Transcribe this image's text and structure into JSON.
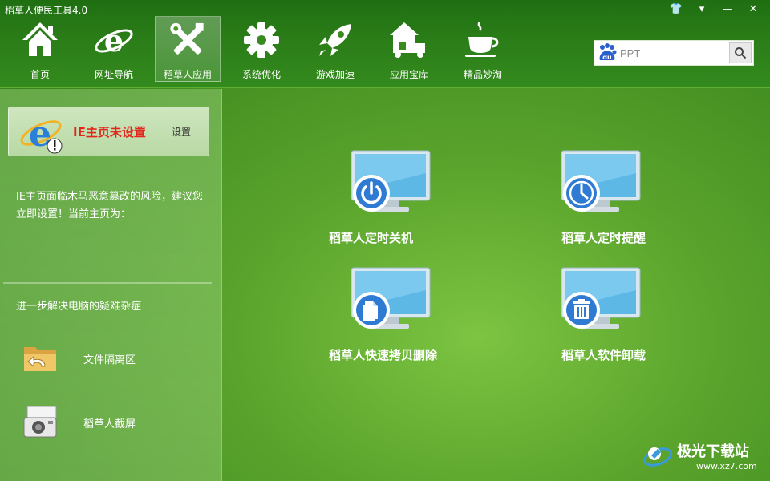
{
  "window": {
    "title": "稻草人便民工具4.0",
    "buttons": {
      "skin": "👕",
      "menu": "▾",
      "minimize": "—",
      "close": "✕"
    }
  },
  "nav": {
    "items": [
      {
        "label": "首页",
        "icon": "home-icon"
      },
      {
        "label": "网址导航",
        "icon": "ie-browser-icon"
      },
      {
        "label": "稻草人应用",
        "icon": "tools-icon",
        "active": true
      },
      {
        "label": "系统优化",
        "icon": "gear-icon"
      },
      {
        "label": "游戏加速",
        "icon": "rocket-icon"
      },
      {
        "label": "应用宝库",
        "icon": "store-icon"
      },
      {
        "label": "精品妙淘",
        "icon": "coffee-cup-icon"
      }
    ]
  },
  "search": {
    "placeholder": "PPT",
    "logo_text": "du"
  },
  "sidebar": {
    "ie_status": "IE主页未设置",
    "ie_set_label": "设置",
    "ie_description": "IE主页面临木马恶意篡改的风险，建议您立即设置！当前主页为：",
    "more_title": "进一步解决电脑的疑难杂症",
    "tools": [
      {
        "label": "文件隔离区",
        "icon": "folder-restore-icon"
      },
      {
        "label": "稻草人截屏",
        "icon": "camera-icon"
      }
    ]
  },
  "apps": [
    {
      "label": "稻草人定时关机",
      "icon": "power-icon"
    },
    {
      "label": "稻草人定时提醒",
      "icon": "clock-icon"
    },
    {
      "label": "稻草人快速拷贝删除",
      "icon": "copy-icon"
    },
    {
      "label": "稻草人软件卸载",
      "icon": "trash-icon"
    }
  ],
  "watermark": {
    "main": "极光下载站",
    "sub": "www.xz7.com"
  },
  "colors": {
    "accent_red": "#e3261b",
    "green_dark": "#2b7d18",
    "green_light": "#7cc441"
  }
}
